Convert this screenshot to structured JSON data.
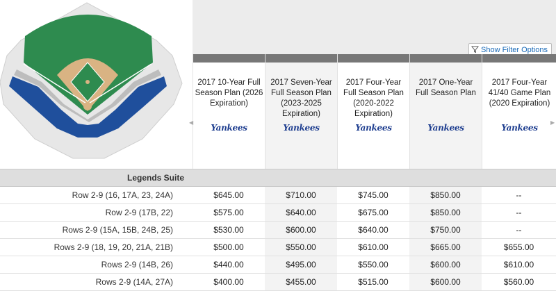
{
  "filter_button": {
    "label": "Show Filter Options",
    "icon": "funnel-icon"
  },
  "colors": {
    "header_bar": "#777777",
    "section_bg": "#dedede",
    "shaded_col": "#f3f3f3",
    "field_green": "#2e8b4f",
    "infield_dirt": "#d9b383",
    "seat_blue": "#1f4f9c",
    "logo_blue": "#1d3d8f",
    "link_blue": "#1b6bb8"
  },
  "map": {
    "icon": "stadium-seating-map"
  },
  "plans": [
    {
      "name": "2017 10-Year Full Season Plan (2026 Expiration)",
      "logo": "Yankees"
    },
    {
      "name": "2017 Seven-Year Full Season Plan (2023-2025 Expiration)",
      "logo": "Yankees"
    },
    {
      "name": "2017 Four-Year Full Season Plan (2020-2022 Expiration)",
      "logo": "Yankees"
    },
    {
      "name": "2017 One-Year Full Season Plan",
      "logo": "Yankees"
    },
    {
      "name": "2017 Four-Year 41/40 Game Plan (2020 Expiration)",
      "logo": "Yankees"
    }
  ],
  "section": {
    "title": "Legends Suite"
  },
  "rows": [
    {
      "label": "Row 2-9 (16, 17A, 23, 24A)",
      "prices": [
        "$645.00",
        "$710.00",
        "$745.00",
        "$850.00",
        "--"
      ]
    },
    {
      "label": "Row 2-9 (17B, 22)",
      "prices": [
        "$575.00",
        "$640.00",
        "$675.00",
        "$850.00",
        "--"
      ]
    },
    {
      "label": "Rows 2-9 (15A, 15B, 24B, 25)",
      "prices": [
        "$530.00",
        "$600.00",
        "$640.00",
        "$750.00",
        "--"
      ]
    },
    {
      "label": "Rows 2-9 (18, 19, 20, 21A, 21B)",
      "prices": [
        "$500.00",
        "$550.00",
        "$610.00",
        "$665.00",
        "$655.00"
      ]
    },
    {
      "label": "Rows 2-9 (14B, 26)",
      "prices": [
        "$440.00",
        "$495.00",
        "$550.00",
        "$600.00",
        "$610.00"
      ]
    },
    {
      "label": "Rows 2-9 (14A, 27A)",
      "prices": [
        "$400.00",
        "$455.00",
        "$515.00",
        "$600.00",
        "$560.00"
      ]
    }
  ]
}
